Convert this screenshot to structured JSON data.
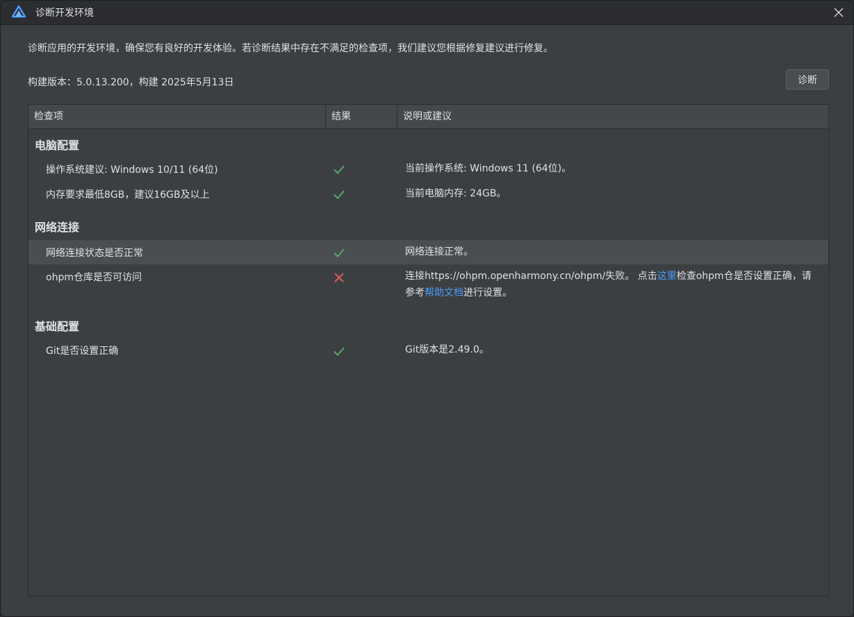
{
  "window": {
    "title": "诊断开发环境"
  },
  "intro": "诊断应用的开发环境，确保您有良好的开发体验。若诊断结果中存在不满足的检查项，我们建议您根据修复建议进行修复。",
  "build_info": "构建版本：5.0.13.200，构建 2025年5月13日",
  "diagnose_button": "诊断",
  "table": {
    "headers": [
      "检查项",
      "结果",
      "说明或建议"
    ],
    "sections": [
      {
        "title": "电脑配置",
        "rows": [
          {
            "check": "操作系统建议: Windows 10/11 (64位)",
            "result": "pass",
            "desc": "当前操作系统: Windows 11 (64位)。"
          },
          {
            "check": "内存要求最低8GB，建议16GB及以上",
            "result": "pass",
            "desc": "当前电脑内存: 24GB。"
          }
        ]
      },
      {
        "title": "网络连接",
        "rows": [
          {
            "check": "网络连接状态是否正常",
            "result": "pass",
            "desc": "网络连接正常。"
          },
          {
            "check": "ohpm仓库是否可访问",
            "result": "fail",
            "desc_parts": {
              "p1": "连接https://ohpm.openharmony.cn/ohpm/失败。 点击",
              "link1": "这里",
              "p2": "检查ohpm仓是否设置正确，请参考",
              "link2": "帮助文档",
              "p3": "进行设置。"
            }
          }
        ]
      },
      {
        "title": "基础配置",
        "rows": [
          {
            "check": "Git是否设置正确",
            "result": "pass",
            "desc": "Git版本是2.49.0。"
          }
        ]
      }
    ]
  },
  "colors": {
    "pass": "#59a869",
    "fail": "#db5c5c",
    "link": "#4a9eff"
  }
}
